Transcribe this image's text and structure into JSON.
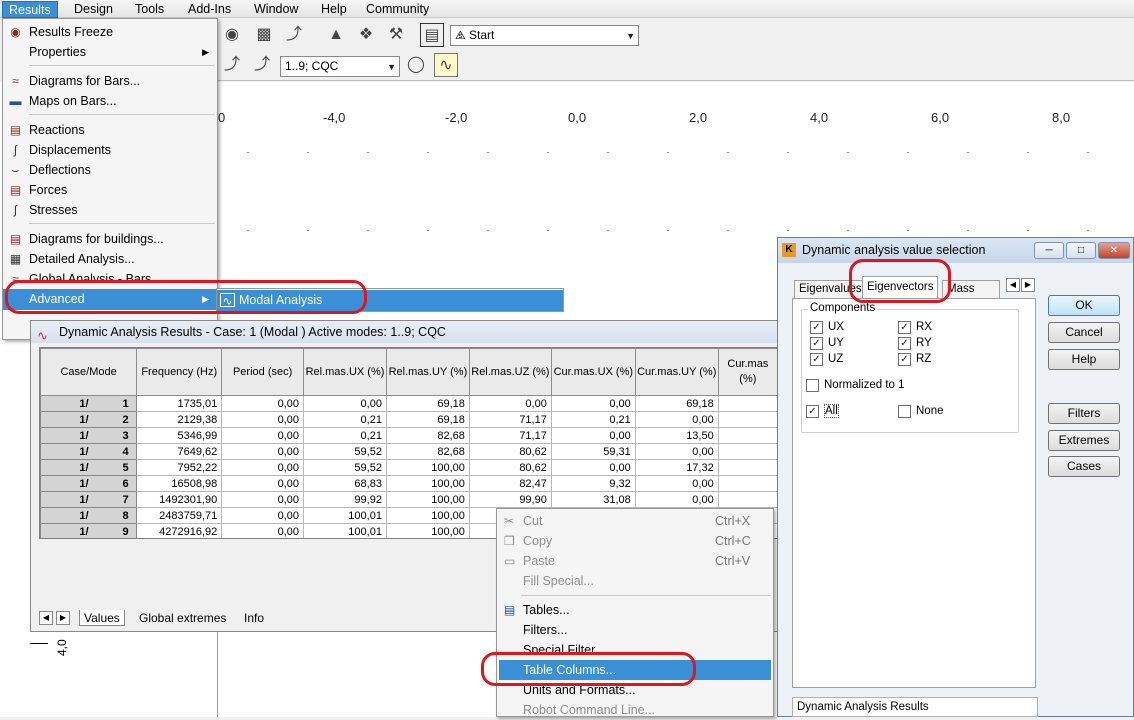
{
  "menubar": {
    "items": [
      "Results",
      "Design",
      "Tools",
      "Add-Ins",
      "Window",
      "Help",
      "Community"
    ]
  },
  "toolbar": {
    "start_combo": "Start",
    "cqc_combo": "1..9; CQC"
  },
  "view": {
    "x_labels": [
      "0",
      "-4,0",
      "-2,0",
      "0,0",
      "2,0",
      "4,0",
      "6,0",
      "8,0"
    ],
    "y_label": "4,0"
  },
  "results_menu": {
    "items": [
      {
        "label": "Results Freeze",
        "icon": "results-freeze-icon"
      },
      {
        "label": "Properties",
        "icon": "",
        "submenu": true
      },
      {
        "label": "Diagrams for Bars...",
        "icon": "diagram-bars-icon"
      },
      {
        "label": "Maps on Bars...",
        "icon": "maps-bars-icon"
      },
      {
        "label": "Reactions",
        "icon": "reactions-icon"
      },
      {
        "label": "Displacements",
        "icon": "displacements-icon"
      },
      {
        "label": "Deflections",
        "icon": "deflections-icon"
      },
      {
        "label": "Forces",
        "icon": "forces-icon"
      },
      {
        "label": "Stresses",
        "icon": "stresses-icon"
      },
      {
        "label": "Diagrams for buildings...",
        "icon": "diagram-buildings-icon"
      },
      {
        "label": "Detailed Analysis...",
        "icon": "detailed-analysis-icon"
      },
      {
        "label": "Global Analysis - Bars",
        "icon": "global-analysis-icon"
      },
      {
        "label": "Advanced",
        "icon": "",
        "submenu": true
      }
    ],
    "submenu_item": "Modal Analysis"
  },
  "dyn_window": {
    "title": "Dynamic Analysis Results - Case: 1 (Modal ) Active modes: 1..9; CQC",
    "columns": [
      "Case/Mode",
      "Frequency (Hz)",
      "Period (sec)",
      "Rel.mas.UX (%)",
      "Rel.mas.UY (%)",
      "Rel.mas.UZ (%)",
      "Cur.mas.UX (%)",
      "Cur.mas.UY (%)",
      "Cur.mas (%)"
    ],
    "rows": [
      {
        "case": "1/",
        "mode": "1",
        "freq": "1735,01",
        "period": "0,00",
        "rux": "0,00",
        "ruy": "69,18",
        "ruz": "0,00",
        "cux": "0,00",
        "cuy": "69,18"
      },
      {
        "case": "1/",
        "mode": "2",
        "freq": "2129,38",
        "period": "0,00",
        "rux": "0,21",
        "ruy": "69,18",
        "ruz": "71,17",
        "cux": "0,21",
        "cuy": "0,00"
      },
      {
        "case": "1/",
        "mode": "3",
        "freq": "5346,99",
        "period": "0,00",
        "rux": "0,21",
        "ruy": "82,68",
        "ruz": "71,17",
        "cux": "0,00",
        "cuy": "13,50"
      },
      {
        "case": "1/",
        "mode": "4",
        "freq": "7649,62",
        "period": "0,00",
        "rux": "59,52",
        "ruy": "82,68",
        "ruz": "80,62",
        "cux": "59,31",
        "cuy": "0,00"
      },
      {
        "case": "1/",
        "mode": "5",
        "freq": "7952,22",
        "period": "0,00",
        "rux": "59,52",
        "ruy": "100,00",
        "ruz": "80,62",
        "cux": "0,00",
        "cuy": "17,32"
      },
      {
        "case": "1/",
        "mode": "6",
        "freq": "16508,98",
        "period": "0,00",
        "rux": "68,83",
        "ruy": "100,00",
        "ruz": "82,47",
        "cux": "9,32",
        "cuy": "0,00"
      },
      {
        "case": "1/",
        "mode": "7",
        "freq": "1492301,90",
        "period": "0,00",
        "rux": "99,92",
        "ruy": "100,00",
        "ruz": "99,90",
        "cux": "31,08",
        "cuy": "0,00"
      },
      {
        "case": "1/",
        "mode": "8",
        "freq": "2483759,71",
        "period": "0,00",
        "rux": "100,01",
        "ruy": "100,00",
        "ruz": "",
        "cux": "",
        "cuy": ""
      },
      {
        "case": "1/",
        "mode": "9",
        "freq": "4272916,92",
        "period": "0,00",
        "rux": "100,01",
        "ruy": "100,00",
        "ruz": "",
        "cux": "",
        "cuy": ""
      }
    ],
    "sheet_tabs": [
      "Values",
      "Global extremes",
      "Info"
    ]
  },
  "context_menu": {
    "items": [
      {
        "label": "Cut",
        "shortcut": "Ctrl+X",
        "disabled": true,
        "icon": "cut-icon"
      },
      {
        "label": "Copy",
        "shortcut": "Ctrl+C",
        "disabled": true,
        "icon": "copy-icon"
      },
      {
        "label": "Paste",
        "shortcut": "Ctrl+V",
        "disabled": true,
        "icon": "paste-icon"
      },
      {
        "label": "Fill Special...",
        "shortcut": "",
        "disabled": true,
        "icon": ""
      },
      {
        "label": "Tables...",
        "shortcut": "",
        "disabled": false,
        "icon": "tables-icon"
      },
      {
        "label": "Filters...",
        "shortcut": "",
        "disabled": false,
        "icon": ""
      },
      {
        "label": "Special Filter",
        "shortcut": "",
        "disabled": false,
        "icon": ""
      },
      {
        "label": "Table Columns...",
        "shortcut": "",
        "disabled": false,
        "icon": ""
      },
      {
        "label": "Units and Formats...",
        "shortcut": "",
        "disabled": false,
        "icon": ""
      },
      {
        "label": "Robot Command Line...",
        "shortcut": "",
        "disabled": true,
        "icon": ""
      }
    ]
  },
  "dialog": {
    "title": "Dynamic analysis value selection",
    "tabs": [
      "Eigenvalues",
      "Eigenvectors",
      "Mass sums"
    ],
    "group_label": "Components",
    "checkboxes": [
      {
        "label": "UX",
        "checked": true
      },
      {
        "label": "RX",
        "checked": true
      },
      {
        "label": "UY",
        "checked": true
      },
      {
        "label": "RY",
        "checked": true
      },
      {
        "label": "UZ",
        "checked": true
      },
      {
        "label": "RZ",
        "checked": true
      },
      {
        "label": "Normalized to 1",
        "checked": false
      },
      {
        "label": "All",
        "checked": true
      },
      {
        "label": "None",
        "checked": false
      }
    ],
    "buttons": [
      "OK",
      "Cancel",
      "Help",
      "Filters",
      "Extremes",
      "Cases"
    ],
    "status": "Dynamic Analysis Results"
  },
  "colors": {
    "highlight": "#3b8fd7",
    "annotation": "#e0151e"
  }
}
